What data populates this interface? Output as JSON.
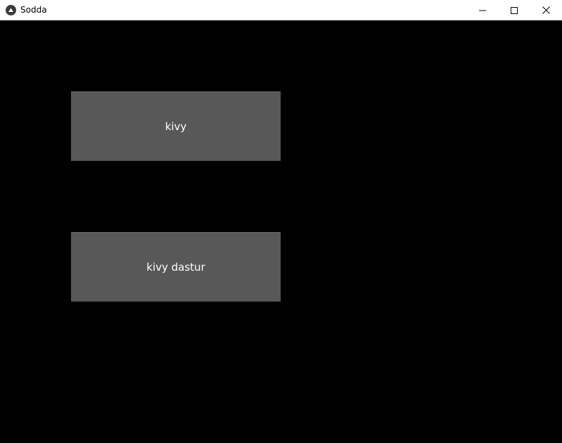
{
  "window": {
    "title": "Sodda",
    "icon": "kivy-logo-icon",
    "controls": {
      "minimize": "minimize-icon",
      "maximize": "maximize-icon",
      "close": "close-icon"
    }
  },
  "buttons": [
    {
      "label": "kivy"
    },
    {
      "label": "kivy dastur"
    }
  ],
  "colors": {
    "background": "#000000",
    "button_fill": "#585858",
    "button_text": "#ffffff",
    "titlebar": "#ffffff"
  }
}
